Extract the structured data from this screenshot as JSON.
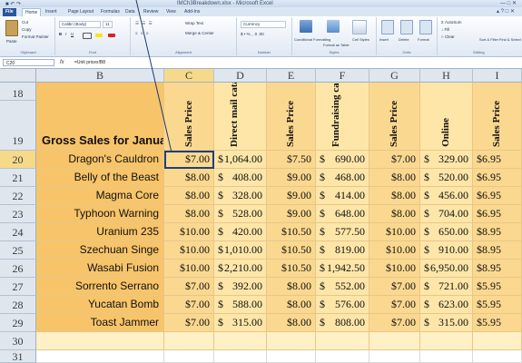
{
  "window": {
    "title": "IMCh3Breakdown.xlsx - Microsoft Excel",
    "qa_icons": [
      "save-icon",
      "undo-icon",
      "redo-icon"
    ]
  },
  "tabs": [
    "File",
    "Home",
    "Insert",
    "Page Layout",
    "Formulas",
    "Data",
    "Review",
    "View",
    "Add-Ins"
  ],
  "ribbon": {
    "clipboard": {
      "label": "Clipboard",
      "cut": "Cut",
      "copy": "Copy",
      "painter": "Format Painter",
      "paste": "Paste"
    },
    "font": {
      "label": "Font",
      "name": "Calibri (Body)",
      "size": "11"
    },
    "alignment": {
      "label": "Alignment",
      "wrap": "Wrap Text",
      "merge": "Merge & Center"
    },
    "number": {
      "label": "Number",
      "format": "Currency"
    },
    "styles": {
      "label": "Styles",
      "cond": "Conditional Formatting",
      "table": "Format as Table",
      "cell": "Cell Styles"
    },
    "cells": {
      "label": "Cells",
      "insert": "Insert",
      "delete": "Delete",
      "format": "Format"
    },
    "editing": {
      "label": "Editing",
      "autosum": "AutoSum",
      "fill": "Fill",
      "clear": "Clear",
      "sort": "Sort & Filter",
      "find": "Find & Select"
    }
  },
  "formula_bar": {
    "name_box": "C20",
    "fx": "fx",
    "formula": "=Unit prices!B8"
  },
  "columns": [
    "B",
    "C",
    "D",
    "E",
    "F",
    "G",
    "H",
    "I"
  ],
  "rows": [
    "18",
    "19",
    "20",
    "21",
    "22",
    "23",
    "24",
    "25",
    "26",
    "27",
    "28",
    "29",
    "30",
    "31"
  ],
  "header_row": {
    "title": "Gross Sales for January",
    "columns": [
      "Sales Price",
      "Direct mail catalog",
      "Sales Price",
      "Fundraising catalog",
      "Sales Price",
      "Online",
      "Sales Price"
    ]
  },
  "products": [
    {
      "name": "Dragon's Cauldron",
      "c": "$7.00",
      "d": "1,064.00",
      "e": "$7.50",
      "f": "690.00",
      "g": "$7.00",
      "h": "329.00",
      "i": "$6.95"
    },
    {
      "name": "Belly of the Beast",
      "c": "$8.00",
      "d": "408.00",
      "e": "$9.00",
      "f": "468.00",
      "g": "$8.00",
      "h": "520.00",
      "i": "$6.95"
    },
    {
      "name": "Magma Core",
      "c": "$8.00",
      "d": "328.00",
      "e": "$9.00",
      "f": "414.00",
      "g": "$8.00",
      "h": "456.00",
      "i": "$6.95"
    },
    {
      "name": "Typhoon Warning",
      "c": "$8.00",
      "d": "528.00",
      "e": "$9.00",
      "f": "648.00",
      "g": "$8.00",
      "h": "704.00",
      "i": "$6.95"
    },
    {
      "name": "Uranium 235",
      "c": "$10.00",
      "d": "420.00",
      "e": "$10.50",
      "f": "577.50",
      "g": "$10.00",
      "h": "650.00",
      "i": "$8.95"
    },
    {
      "name": "Szechuan Singe",
      "c": "$10.00",
      "d": "1,010.00",
      "e": "$10.50",
      "f": "819.00",
      "g": "$10.00",
      "h": "910.00",
      "i": "$8.95"
    },
    {
      "name": "Wasabi Fusion",
      "c": "$10.00",
      "d": "2,210.00",
      "e": "$10.50",
      "f": "1,942.50",
      "g": "$10.00",
      "h": "6,950.00",
      "i": "$8.95"
    },
    {
      "name": "Sorrento Serrano",
      "c": "$7.00",
      "d": "392.00",
      "e": "$8.00",
      "f": "552.00",
      "g": "$7.00",
      "h": "721.00",
      "i": "$5.95"
    },
    {
      "name": "Yucatan Bomb",
      "c": "$7.00",
      "d": "588.00",
      "e": "$8.00",
      "f": "576.00",
      "g": "$7.00",
      "h": "623.00",
      "i": "$5.95"
    },
    {
      "name": "Toast Jammer",
      "c": "$7.00",
      "d": "315.00",
      "e": "$8.00",
      "f": "808.00",
      "g": "$7.00",
      "h": "315.00",
      "i": "$5.95"
    }
  ],
  "currency_symbol": "$",
  "selected_cell": "C20",
  "colors": {
    "accent": "#2a5699",
    "selection": "#1f3f7a",
    "header_highlight": "#f7d98a",
    "fill_b": "#f7c46a",
    "fill_price": "#fbd890"
  }
}
